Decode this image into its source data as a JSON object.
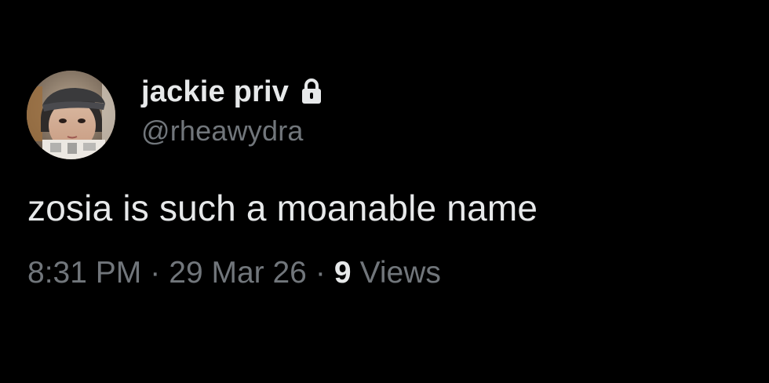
{
  "user": {
    "display_name": "jackie priv",
    "handle": "@rheawydra",
    "protected_icon": "lock-icon",
    "avatar_icon": "profile-photo"
  },
  "tweet": {
    "text": "zosia is such a moanable name"
  },
  "meta": {
    "time": "8:31 PM",
    "separator": "·",
    "date": "29 Mar 26",
    "views_count": "9",
    "views_label": "Views"
  },
  "colors": {
    "background": "#000000",
    "primary_text": "#e7e9ea",
    "secondary_text": "#71767b"
  }
}
